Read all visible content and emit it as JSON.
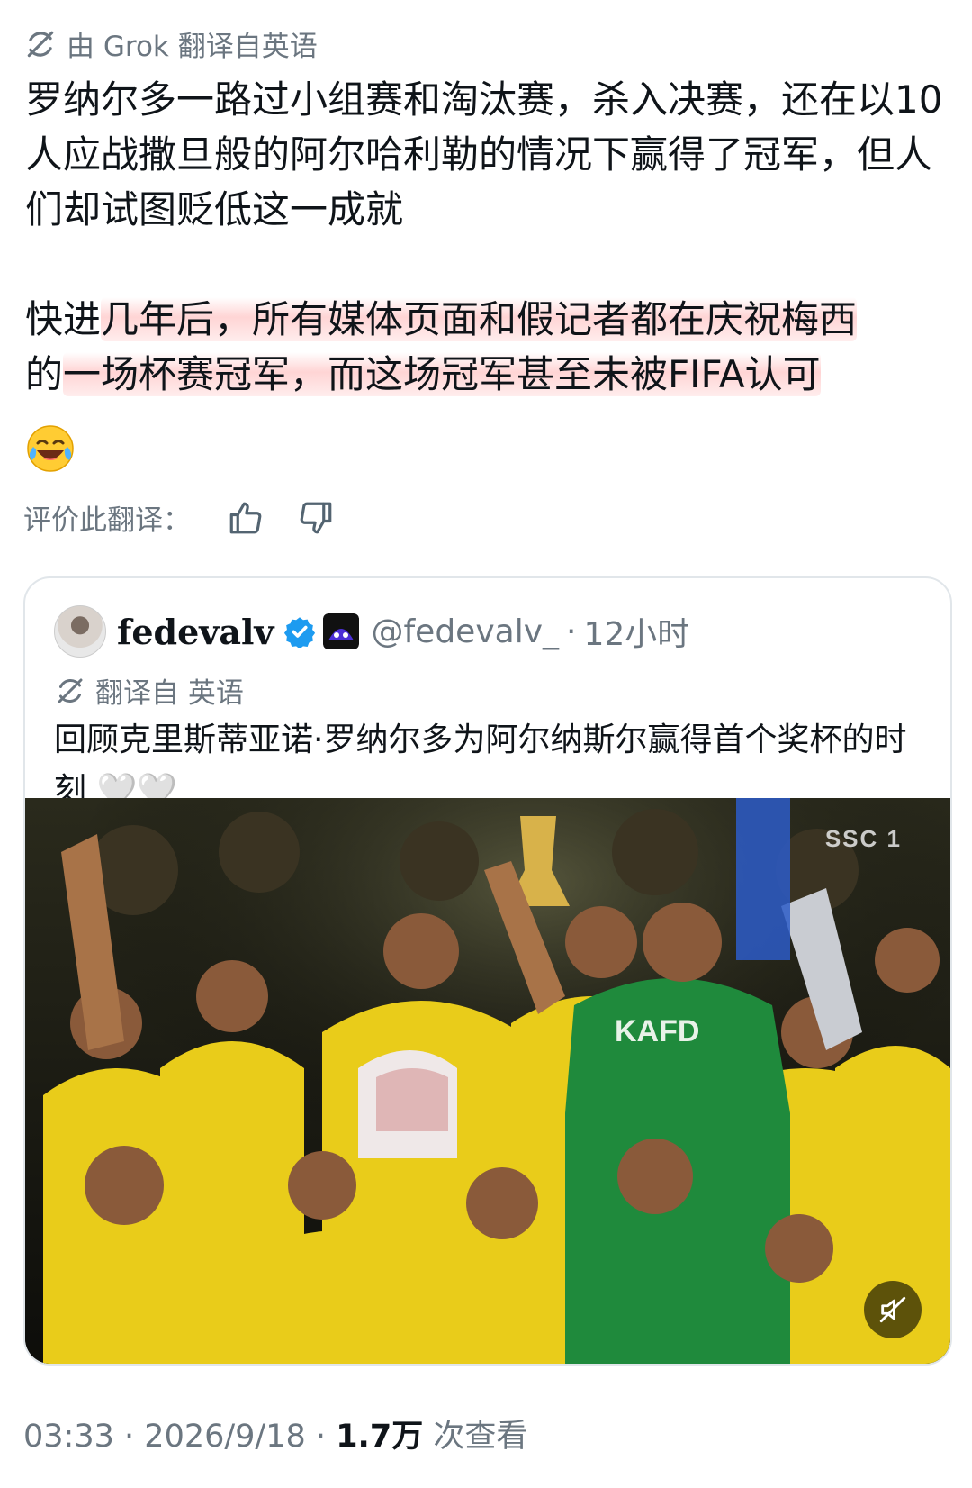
{
  "translation": {
    "label": "由 Grok 翻译自英语"
  },
  "post": {
    "paragraph1": "罗纳尔多一路过小组赛和淘汰赛，杀入决赛，还在以10人应战撒旦般的阿尔哈利勒的情况下赢得了冠军，但人们却试图贬低这一成就",
    "paragraph2_plain": "快进",
    "paragraph2_highlight_line1": "几年后，所有媒体页面和假记者都在庆祝梅西",
    "paragraph2_line2_plain": "的",
    "paragraph2_highlight_line2": "一场杯赛冠军，而这场冠军甚至未被FIFA认可",
    "emoji": "😂"
  },
  "rating": {
    "label": "评价此翻译：",
    "thumbs_up_icon": "thumbs-up-icon",
    "thumbs_down_icon": "thumbs-down-icon"
  },
  "quote": {
    "name": "fedevalv",
    "handle": "@fedevalv_",
    "separator": "·",
    "time": "12小时",
    "translated_label": "翻译自 英语",
    "text": "回顾克里斯蒂亚诺·罗纳尔多为阿尔纳斯尔赢得首个奖杯的时刻 🤍🤍",
    "media": {
      "channel": "SSC 1",
      "jersey_text": "KAFD",
      "mute_icon": "muted-speaker-icon"
    }
  },
  "footer": {
    "time": "03:33",
    "separator": "·",
    "date": "2026/9/18",
    "views_count": "1.7万",
    "views_label": "次查看"
  },
  "colors": {
    "text": "#0f1419",
    "secondary": "#6b7680",
    "highlight": "#ffd4d4",
    "verified": "#1d9bf0",
    "jersey_yellow": "#f2d21e",
    "keeper_green": "#1f8a3c"
  }
}
